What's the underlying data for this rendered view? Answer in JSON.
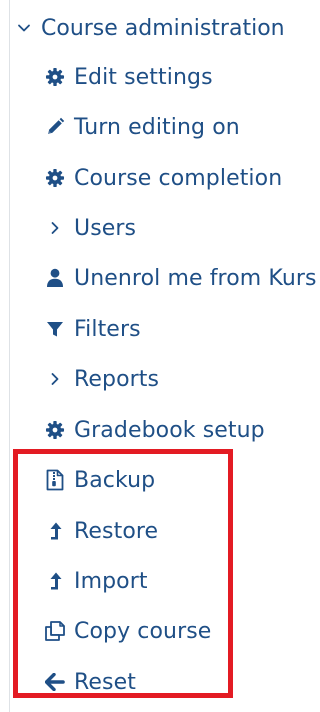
{
  "panel": {
    "header_label": "Course administration",
    "colors": {
      "text": "#1f4f86",
      "highlight": "#e31b23",
      "rule": "#dee2e6"
    }
  },
  "items": [
    {
      "label": "Edit settings",
      "icon": "gear-icon"
    },
    {
      "label": "Turn editing on",
      "icon": "pencil-icon"
    },
    {
      "label": "Course completion",
      "icon": "gear-icon"
    },
    {
      "label": "Users",
      "icon": "chevron-right-icon"
    },
    {
      "label": "Unenrol me from Kurs",
      "icon": "user-icon"
    },
    {
      "label": "Filters",
      "icon": "filter-icon"
    },
    {
      "label": "Reports",
      "icon": "chevron-right-icon"
    },
    {
      "label": "Gradebook setup",
      "icon": "gear-icon"
    },
    {
      "label": "Backup",
      "icon": "file-archive-icon"
    },
    {
      "label": "Restore",
      "icon": "level-up-icon"
    },
    {
      "label": "Import",
      "icon": "level-up-icon"
    },
    {
      "label": "Copy course",
      "icon": "copy-icon"
    },
    {
      "label": "Reset",
      "icon": "arrow-left-icon"
    }
  ]
}
